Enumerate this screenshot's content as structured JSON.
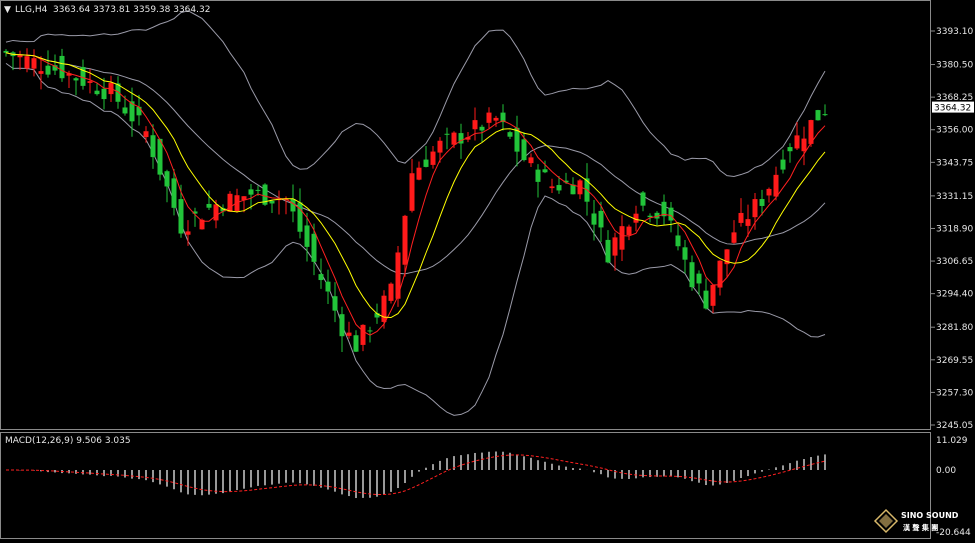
{
  "header": {
    "arrow_glyph": "▼",
    "symbol_timeframe": "LLG,H4",
    "ohlc": "3363.64 3373.81 3359.38 3364.32"
  },
  "macd_header": "MACD(12,26,9) 9.506 3.035",
  "watermark": {
    "brand": "SINO SOUND",
    "cjk": "漢 聲 集 團",
    "icon": "diamond-logo-icon"
  },
  "colors": {
    "background": "#000000",
    "frame": "#8a8a8a",
    "bull_candle": "#ff1a1a",
    "bear_candle": "#22c43a",
    "bollinger": "#9a9aa8",
    "ma_fast": "#ff2020",
    "ma_slow": "#ffff00",
    "macd_hist": "#ffffff",
    "macd_signal": "#ff2020",
    "current_price_box": "#ffffff"
  },
  "chart_data": [
    {
      "type": "candlestick",
      "title": "LLG,H4",
      "price_axis_ticks": [
        "3393.10",
        "3380.50",
        "3368.25",
        "3356.00",
        "3343.75",
        "3331.15",
        "3318.90",
        "3306.65",
        "3294.40",
        "3281.80",
        "3269.55",
        "3257.30",
        "3245.05"
      ],
      "current_price": "3364.32",
      "ylim": [
        3245.05,
        3399.0
      ],
      "grid": false,
      "overlays": [
        "bollinger_bands",
        "moving_average_fast",
        "moving_average_slow"
      ]
    },
    {
      "type": "bar",
      "title": "MACD(12,26,9)",
      "macd_value": 9.506,
      "signal_value": 3.035,
      "axis_ticks": [
        "11.029",
        "0.00",
        "-20.644"
      ],
      "ylim": [
        -20.644,
        11.029
      ],
      "grid": false
    }
  ]
}
